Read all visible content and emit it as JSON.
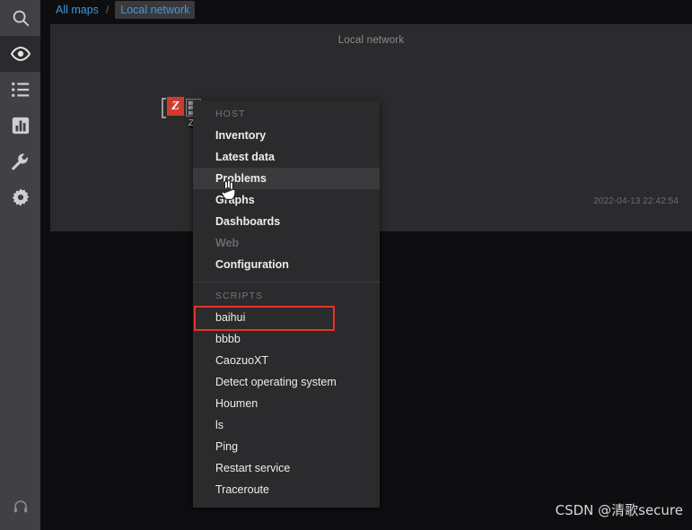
{
  "sidebar": {
    "top_items": [
      {
        "name": "search-icon",
        "label": "Search"
      },
      {
        "name": "monitoring-eye-icon",
        "label": "Monitoring",
        "active": true
      },
      {
        "name": "list-icon",
        "label": "Inventory"
      },
      {
        "name": "bar-chart-icon",
        "label": "Reports"
      },
      {
        "name": "wrench-icon",
        "label": "Configuration"
      },
      {
        "name": "gear-icon",
        "label": "Administration"
      }
    ],
    "bottom_items": [
      {
        "name": "headset-support-icon",
        "label": "Support"
      }
    ]
  },
  "breadcrumb": {
    "root": "All maps",
    "separator": "/",
    "current": "Local network"
  },
  "map": {
    "title": "Local network",
    "timestamp": "2022-04-13 22:42:54",
    "node": {
      "logo_letter": "Z",
      "label": "Z"
    }
  },
  "context_menu": {
    "sections": [
      {
        "label": "HOST",
        "items": [
          {
            "label": "Inventory",
            "state": "normal"
          },
          {
            "label": "Latest data",
            "state": "normal"
          },
          {
            "label": "Problems",
            "state": "hovered"
          },
          {
            "label": "Graphs",
            "state": "normal"
          },
          {
            "label": "Dashboards",
            "state": "normal"
          },
          {
            "label": "Web",
            "state": "disabled"
          },
          {
            "label": "Configuration",
            "state": "normal"
          }
        ]
      },
      {
        "label": "SCRIPTS",
        "items": [
          {
            "label": "baihui",
            "state": "normal",
            "highlighted": true
          },
          {
            "label": "bbbb",
            "state": "normal"
          },
          {
            "label": "CaozuoXT",
            "state": "normal"
          },
          {
            "label": "Detect operating system",
            "state": "normal"
          },
          {
            "label": "Houmen",
            "state": "normal"
          },
          {
            "label": "ls",
            "state": "normal"
          },
          {
            "label": "Ping",
            "state": "normal"
          },
          {
            "label": "Restart service",
            "state": "normal"
          },
          {
            "label": "Traceroute",
            "state": "normal"
          }
        ]
      }
    ]
  },
  "watermark": "CSDN @清歌secure",
  "colors": {
    "accent_link": "#4297d7",
    "highlight_box": "#e8312b",
    "zabbix_red": "#d13b2e",
    "menu_bg": "#2b2b2d",
    "sidebar_bg": "#414144",
    "page_bg": "#0e0e10"
  }
}
